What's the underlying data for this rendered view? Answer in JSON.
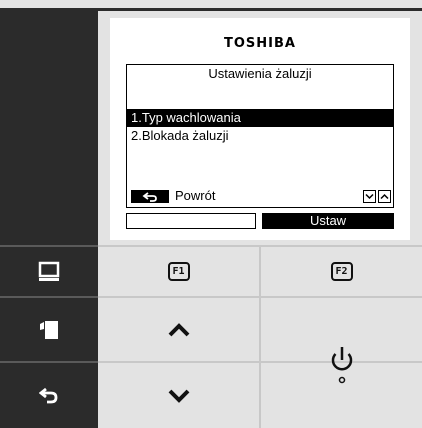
{
  "brand": "TOSHIBA",
  "menu": {
    "title": "Ustawienia żaluzji",
    "items": [
      {
        "label": "1.Typ wachlowania",
        "selected": true
      },
      {
        "label": "2.Blokada żaluzji",
        "selected": false
      }
    ]
  },
  "footer": {
    "back_label": "Powrót",
    "soft_left_label": "",
    "soft_right_label": "Ustaw"
  },
  "buttons": {
    "f1": "F1",
    "f2": "F2"
  },
  "icons": {
    "left_top": "monitor-icon",
    "left_middle": "swing-flap-icon",
    "left_bottom": "back-arrow-icon",
    "up": "chevron-up-icon",
    "down": "chevron-down-icon",
    "power": "power-icon"
  },
  "colors": {
    "dark_panel": "#2b2b2b",
    "button_panel": "#e3e3e3",
    "lcd_background": "#ffffff",
    "highlight": "#000000"
  }
}
